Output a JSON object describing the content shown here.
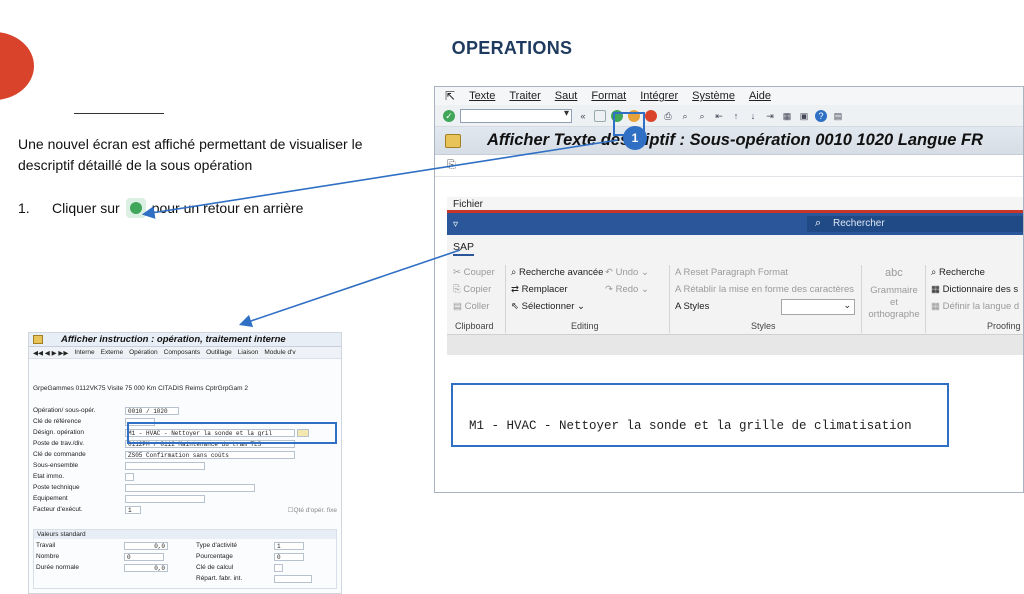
{
  "slide": {
    "title": "OPERATIONS",
    "paragraph": "Une nouvel écran est affiché permettant de visualiser le descriptif détaillé de la sous opération",
    "step_number": "1.",
    "step_text_before": "Cliquer sur",
    "step_text_after": "pour un retour en arrière",
    "callout_number": "1",
    "accent_color": "#d9432c",
    "callout_color": "#2f6fc4"
  },
  "small_screen": {
    "title": "Afficher instruction : opération, traitement interne",
    "toolbar": [
      "Interne",
      "Externe",
      "Opération",
      "Composants",
      "Outillage",
      "Liaison",
      "Module d'v"
    ],
    "header_info": "GrpeGammes  0112VK75 Visite 75 000 Km CITADIS Reims          CptrGrpGam  2",
    "rows": [
      {
        "label": "Opération/ sous-opér.",
        "value": "0010 / 1020"
      },
      {
        "label": "Clé de référence",
        "value": ""
      },
      {
        "label": "Désign. opération",
        "value": "M1 - HVAC - Nettoyer la sonde et la gril"
      },
      {
        "label": "Poste de trav./div.",
        "value": "0112PM    / 0112  Maintenance du tram TLS"
      },
      {
        "label": "Clé de commande",
        "value": "ZS05  Confirmation sans coûts"
      },
      {
        "label": "Sous-ensemble",
        "value": ""
      },
      {
        "label": "Etat immo.",
        "value": ""
      },
      {
        "label": "Poste technique",
        "value": ""
      },
      {
        "label": "Equipement",
        "value": ""
      },
      {
        "label": "Facteur d'exécut.",
        "value": "1"
      }
    ],
    "fixed_qty_label": "Qté d'opér. fixe",
    "section_title": "Valeurs standard",
    "std_left": [
      {
        "label": "Travail",
        "value": "0,0"
      },
      {
        "label": "Nombre",
        "value": "0"
      },
      {
        "label": "Durée normale",
        "value": "0,0"
      }
    ],
    "std_right": [
      {
        "label": "Type d'activité",
        "value": "1"
      },
      {
        "label": "Pourcentage",
        "value": "0"
      },
      {
        "label": "Clé de calcul",
        "value": ""
      },
      {
        "label": "Répart. fabr. int.",
        "value": ""
      }
    ]
  },
  "big_screen": {
    "menu": [
      "Texte",
      "Traiter",
      "Saut",
      "Format",
      "Intégrer",
      "Système",
      "Aide"
    ],
    "title": "Afficher Texte descriptif : Sous-opération 0010 1020 Langue FR",
    "word": {
      "file_tab": "Fichier",
      "search_placeholder": "Rechercher",
      "ribbon_tab": "SAP",
      "clipboard": {
        "cut": "Couper",
        "copy": "Copier",
        "paste": "Coller",
        "group": "Clipboard"
      },
      "editing": {
        "advanced_search": "Recherche avancée",
        "undo": "Undo",
        "replace": "Remplacer",
        "redo": "Redo",
        "select": "Sélectionner",
        "group": "Editing"
      },
      "styles": {
        "reset": "Reset Paragraph Format",
        "restore": "Rétablir la mise en forme des caractères",
        "styles": "Styles",
        "group": "Styles"
      },
      "proofing": {
        "grammar": "Grammaire et orthographe",
        "abc": "abc",
        "search": "Recherche",
        "dictionary": "Dictionnaire des s",
        "language": "Définir la langue d",
        "group": "Proofing"
      },
      "document_text": "M1 - HVAC - Nettoyer la sonde et la grille de climatisation"
    }
  }
}
